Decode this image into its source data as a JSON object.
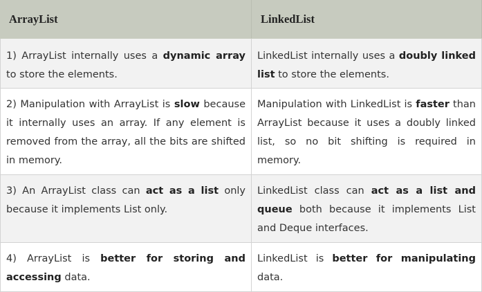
{
  "table": {
    "headers": [
      "ArrayList",
      "LinkedList"
    ],
    "rows": [
      {
        "left": [
          "1) ArrayList internally uses a ",
          "dynamic array",
          " to store the elements."
        ],
        "right": [
          "LinkedList internally uses a ",
          "doubly linked list",
          " to store the elements."
        ]
      },
      {
        "left": [
          "2) Manipulation with ArrayList is ",
          "slow",
          " because it internally uses an array. If any element is removed from the array, all the bits are shifted in memory."
        ],
        "right": [
          "Manipulation with LinkedList is ",
          "faster",
          " than ArrayList because it uses a doubly linked list, so no bit shifting is required in memory."
        ]
      },
      {
        "left": [
          "3) An ArrayList class can ",
          "act as a list",
          " only because it implements List only."
        ],
        "right": [
          "LinkedList class can ",
          "act as a list and queue",
          " both because it implements List and Deque interfaces."
        ]
      },
      {
        "left": [
          "4) ArrayList is ",
          "better for storing and accessing",
          " data."
        ],
        "right": [
          "LinkedList is ",
          "better for manipulating",
          " data."
        ]
      }
    ]
  }
}
